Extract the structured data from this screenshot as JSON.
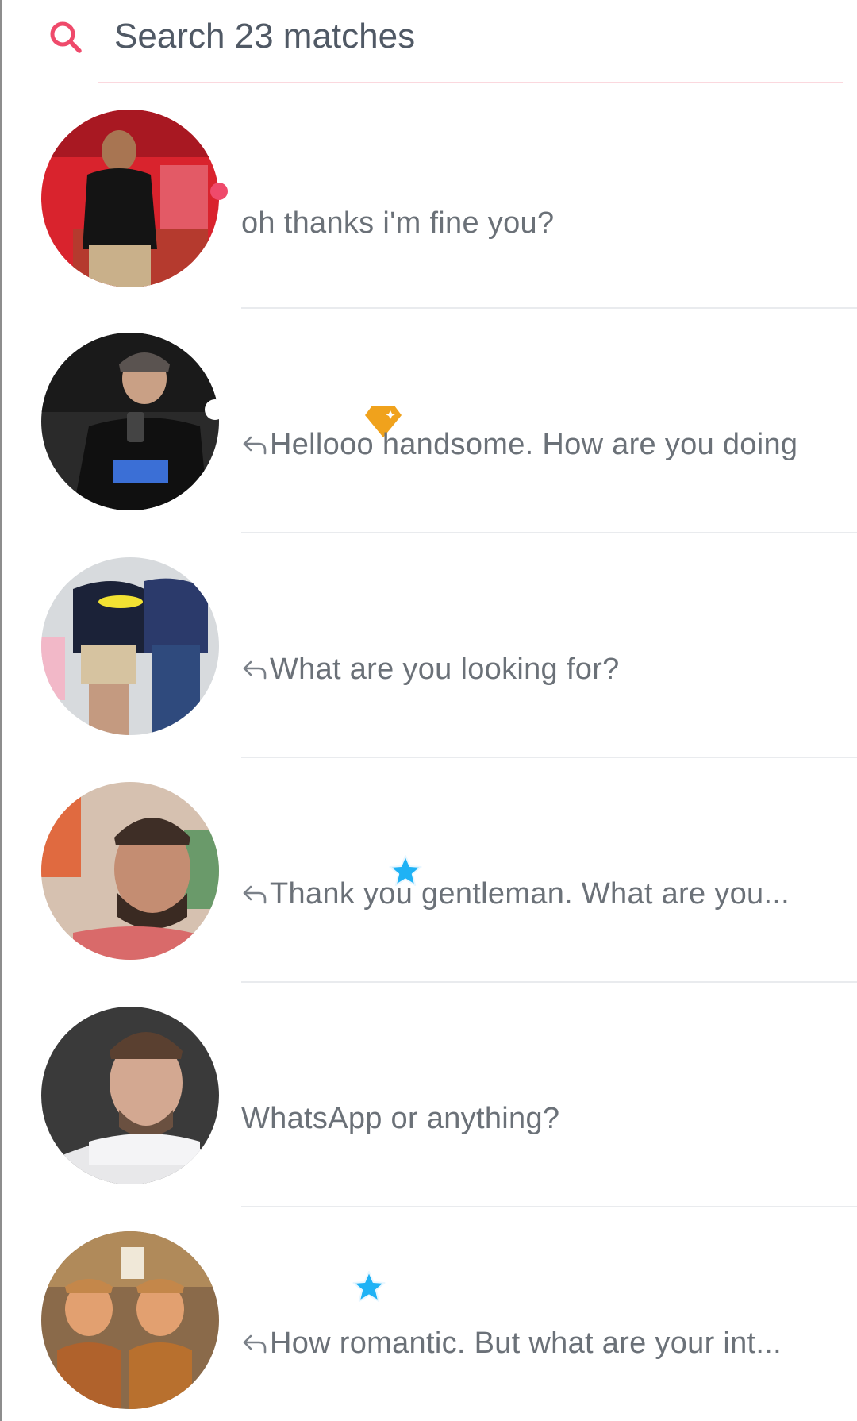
{
  "search": {
    "placeholder": "Search 23 matches",
    "icon": "search-icon",
    "accent_color": "#ef4a6b"
  },
  "matches": [
    {
      "message": "oh thanks i'm fine you?",
      "replied": false,
      "badge": "unread-dot",
      "avatar_bg": "#d9232d"
    },
    {
      "message": "Hellooo handsome. How are you doing",
      "replied": true,
      "badge": "gold-diamond",
      "avatar_bg": "#2a2a2a"
    },
    {
      "message": "What are you looking for?",
      "replied": true,
      "badge": "none",
      "avatar_bg": "#cfd3d8"
    },
    {
      "message": "Thank you gentleman. What are you...",
      "replied": true,
      "badge": "blue-star",
      "avatar_bg": "#c9a58c"
    },
    {
      "message": "WhatsApp or anything?",
      "replied": false,
      "badge": "none",
      "avatar_bg": "#3a3a3a"
    },
    {
      "message": "How romantic. But what are your int...",
      "replied": true,
      "badge": "blue-star",
      "avatar_bg": "#a36b3a"
    }
  ],
  "colors": {
    "message_text": "#6b7178",
    "separator": "#e9ebee",
    "gold_badge": "#f0a21c",
    "blue_star": "#1fb2f5",
    "unread_dot": "#ef4a6b"
  }
}
